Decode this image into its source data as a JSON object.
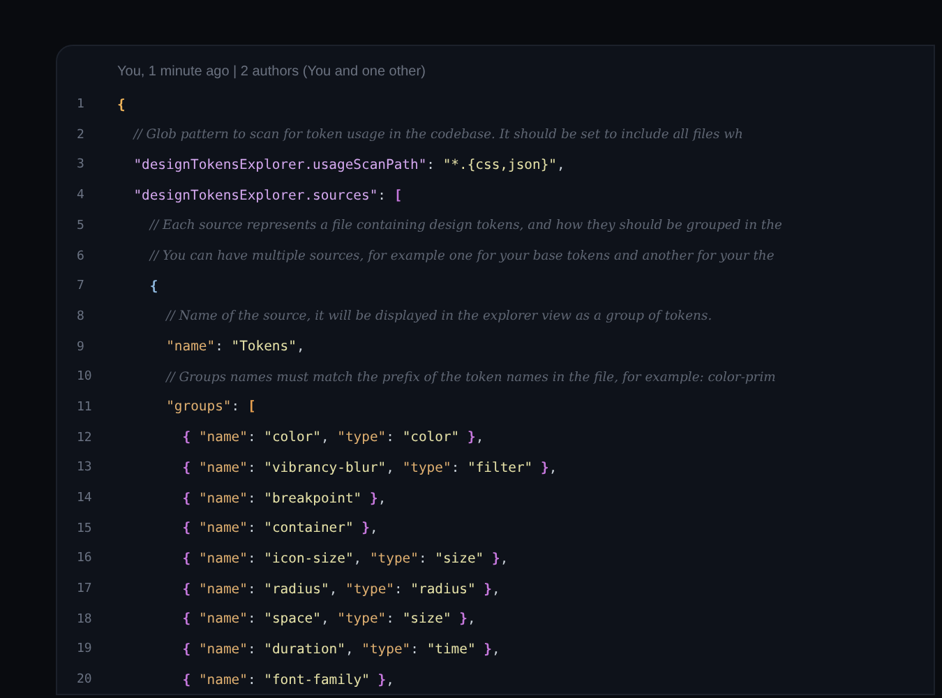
{
  "codelens": "You, 1 minute ago | 2 authors (You and one other)",
  "lines": [
    {
      "number": "1",
      "tokens": [
        {
          "kind": "bracket",
          "text": "{",
          "color": "#f0b45a"
        }
      ]
    },
    {
      "number": "2",
      "tokens": [
        {
          "kind": "comment",
          "text": "// Glob pattern to scan for token usage in the codebase. It should be set to include all files wh"
        }
      ]
    },
    {
      "number": "3",
      "tokens": [
        {
          "kind": "prop",
          "text": "\"designTokensExplorer.usageScanPath\""
        },
        {
          "kind": "punct",
          "text": ": "
        },
        {
          "kind": "string",
          "text": "\"*.{css,json}\""
        },
        {
          "kind": "punct",
          "text": ","
        }
      ]
    },
    {
      "number": "4",
      "tokens": [
        {
          "kind": "prop",
          "text": "\"designTokensExplorer.sources\""
        },
        {
          "kind": "punct",
          "text": ": "
        },
        {
          "kind": "bracket",
          "text": "[",
          "color": "#c678dd"
        }
      ]
    },
    {
      "number": "5",
      "tokens": [
        {
          "kind": "comment",
          "text": "// Each source represents a file containing design tokens, and how they should be grouped in the"
        }
      ]
    },
    {
      "number": "6",
      "tokens": [
        {
          "kind": "comment",
          "text": "// You can have multiple sources, for example one for your base tokens and another for your the"
        }
      ]
    },
    {
      "number": "7",
      "tokens": [
        {
          "kind": "bracket",
          "text": "{",
          "color": "#8fb8de"
        }
      ]
    },
    {
      "number": "8",
      "tokens": [
        {
          "kind": "comment",
          "text": "// Name of the source, it will be displayed in the explorer view as a group of tokens."
        }
      ]
    },
    {
      "number": "9",
      "tokens": [
        {
          "kind": "key",
          "text": "\"name\""
        },
        {
          "kind": "punct",
          "text": ": "
        },
        {
          "kind": "string",
          "text": "\"Tokens\""
        },
        {
          "kind": "punct",
          "text": ","
        }
      ]
    },
    {
      "number": "10",
      "tokens": [
        {
          "kind": "comment",
          "text": "// Groups names must match the prefix of the token names in the file, for example: color-prim"
        }
      ]
    },
    {
      "number": "11",
      "tokens": [
        {
          "kind": "key",
          "text": "\"groups\""
        },
        {
          "kind": "punct",
          "text": ": "
        },
        {
          "kind": "bracket",
          "text": "[",
          "color": "#e8a050"
        }
      ]
    },
    {
      "number": "12",
      "tokens": [
        {
          "kind": "bracket",
          "text": "{",
          "color": "#c678dd"
        },
        {
          "kind": "key",
          "text": " \"name\""
        },
        {
          "kind": "punct",
          "text": ": "
        },
        {
          "kind": "string",
          "text": "\"color\""
        },
        {
          "kind": "punct",
          "text": ", "
        },
        {
          "kind": "key",
          "text": "\"type\""
        },
        {
          "kind": "punct",
          "text": ": "
        },
        {
          "kind": "string",
          "text": "\"color\" "
        },
        {
          "kind": "bracket",
          "text": "}",
          "color": "#c678dd"
        },
        {
          "kind": "punct",
          "text": ","
        }
      ]
    },
    {
      "number": "13",
      "tokens": [
        {
          "kind": "bracket",
          "text": "{",
          "color": "#c678dd"
        },
        {
          "kind": "key",
          "text": " \"name\""
        },
        {
          "kind": "punct",
          "text": ": "
        },
        {
          "kind": "string",
          "text": "\"vibrancy-blur\""
        },
        {
          "kind": "punct",
          "text": ", "
        },
        {
          "kind": "key",
          "text": "\"type\""
        },
        {
          "kind": "punct",
          "text": ": "
        },
        {
          "kind": "string",
          "text": "\"filter\" "
        },
        {
          "kind": "bracket",
          "text": "}",
          "color": "#c678dd"
        },
        {
          "kind": "punct",
          "text": ","
        }
      ]
    },
    {
      "number": "14",
      "tokens": [
        {
          "kind": "bracket",
          "text": "{",
          "color": "#c678dd"
        },
        {
          "kind": "key",
          "text": " \"name\""
        },
        {
          "kind": "punct",
          "text": ": "
        },
        {
          "kind": "string",
          "text": "\"breakpoint\" "
        },
        {
          "kind": "bracket",
          "text": "}",
          "color": "#c678dd"
        },
        {
          "kind": "punct",
          "text": ","
        }
      ]
    },
    {
      "number": "15",
      "tokens": [
        {
          "kind": "bracket",
          "text": "{",
          "color": "#c678dd"
        },
        {
          "kind": "key",
          "text": " \"name\""
        },
        {
          "kind": "punct",
          "text": ": "
        },
        {
          "kind": "string",
          "text": "\"container\" "
        },
        {
          "kind": "bracket",
          "text": "}",
          "color": "#c678dd"
        },
        {
          "kind": "punct",
          "text": ","
        }
      ]
    },
    {
      "number": "16",
      "tokens": [
        {
          "kind": "bracket",
          "text": "{",
          "color": "#c678dd"
        },
        {
          "kind": "key",
          "text": " \"name\""
        },
        {
          "kind": "punct",
          "text": ": "
        },
        {
          "kind": "string",
          "text": "\"icon-size\""
        },
        {
          "kind": "punct",
          "text": ", "
        },
        {
          "kind": "key",
          "text": "\"type\""
        },
        {
          "kind": "punct",
          "text": ": "
        },
        {
          "kind": "string",
          "text": "\"size\" "
        },
        {
          "kind": "bracket",
          "text": "}",
          "color": "#c678dd"
        },
        {
          "kind": "punct",
          "text": ","
        }
      ]
    },
    {
      "number": "17",
      "tokens": [
        {
          "kind": "bracket",
          "text": "{",
          "color": "#c678dd"
        },
        {
          "kind": "key",
          "text": " \"name\""
        },
        {
          "kind": "punct",
          "text": ": "
        },
        {
          "kind": "string",
          "text": "\"radius\""
        },
        {
          "kind": "punct",
          "text": ", "
        },
        {
          "kind": "key",
          "text": "\"type\""
        },
        {
          "kind": "punct",
          "text": ": "
        },
        {
          "kind": "string",
          "text": "\"radius\" "
        },
        {
          "kind": "bracket",
          "text": "}",
          "color": "#c678dd"
        },
        {
          "kind": "punct",
          "text": ","
        }
      ]
    },
    {
      "number": "18",
      "tokens": [
        {
          "kind": "bracket",
          "text": "{",
          "color": "#c678dd"
        },
        {
          "kind": "key",
          "text": " \"name\""
        },
        {
          "kind": "punct",
          "text": ": "
        },
        {
          "kind": "string",
          "text": "\"space\""
        },
        {
          "kind": "punct",
          "text": ", "
        },
        {
          "kind": "key",
          "text": "\"type\""
        },
        {
          "kind": "punct",
          "text": ": "
        },
        {
          "kind": "string",
          "text": "\"size\" "
        },
        {
          "kind": "bracket",
          "text": "}",
          "color": "#c678dd"
        },
        {
          "kind": "punct",
          "text": ","
        }
      ]
    },
    {
      "number": "19",
      "tokens": [
        {
          "kind": "bracket",
          "text": "{",
          "color": "#c678dd"
        },
        {
          "kind": "key",
          "text": " \"name\""
        },
        {
          "kind": "punct",
          "text": ": "
        },
        {
          "kind": "string",
          "text": "\"duration\""
        },
        {
          "kind": "punct",
          "text": ", "
        },
        {
          "kind": "key",
          "text": "\"type\""
        },
        {
          "kind": "punct",
          "text": ": "
        },
        {
          "kind": "string",
          "text": "\"time\" "
        },
        {
          "kind": "bracket",
          "text": "}",
          "color": "#c678dd"
        },
        {
          "kind": "punct",
          "text": ","
        }
      ]
    },
    {
      "number": "20",
      "tokens": [
        {
          "kind": "bracket",
          "text": "{",
          "color": "#c678dd"
        },
        {
          "kind": "key",
          "text": " \"name\""
        },
        {
          "kind": "punct",
          "text": ": "
        },
        {
          "kind": "string",
          "text": "\"font-family\" "
        },
        {
          "kind": "bracket",
          "text": "}",
          "color": "#c678dd"
        },
        {
          "kind": "punct",
          "text": ","
        }
      ]
    }
  ]
}
